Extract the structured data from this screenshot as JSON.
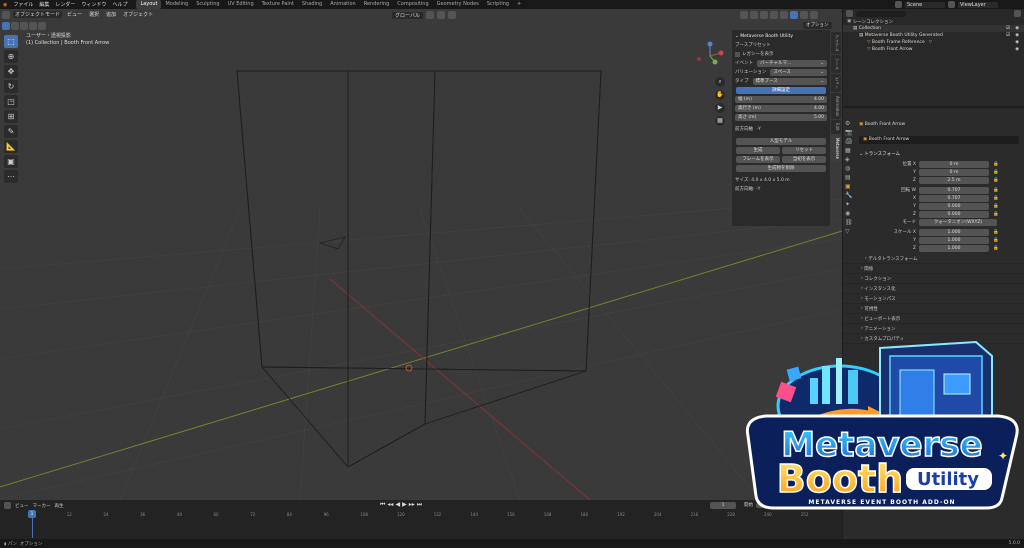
{
  "menu": [
    "ファイル",
    "編集",
    "レンダー",
    "ウィンドウ",
    "ヘルプ"
  ],
  "workspaces": [
    {
      "label": "Layout",
      "active": true
    },
    {
      "label": "Modeling"
    },
    {
      "label": "Sculpting"
    },
    {
      "label": "UV Editing"
    },
    {
      "label": "Texture Paint"
    },
    {
      "label": "Shading"
    },
    {
      "label": "Animation"
    },
    {
      "label": "Rendering"
    },
    {
      "label": "Compositing"
    },
    {
      "label": "Geometry Nodes"
    },
    {
      "label": "Scripting"
    }
  ],
  "scene": {
    "name": "Scene",
    "viewlayer": "ViewLayer"
  },
  "viewport": {
    "mode": "オブジェクトモード",
    "menus": [
      "ビュー",
      "選択",
      "追加",
      "オブジェクト"
    ],
    "orientation": "グローバル",
    "options_label": "オプション",
    "info_line1": "ユーザー・透視投影",
    "info_line2": "(1) Collection | Booth Front Arrow"
  },
  "npanel": {
    "header": "Metaverse Booth Utility",
    "preset_label": "ブースプリセット",
    "legacy_label": "レガシーを表示",
    "event_label": "イベント",
    "event_value": "バーチャルマ...",
    "variation_label": "バリエーション",
    "variation_value": "スペース",
    "type_label": "タイプ",
    "type_value": "標準ブース",
    "detail_btn": "詳細設定",
    "width_label": "幅 (m)",
    "width_value": "4.00",
    "depth_label": "奥行き (m)",
    "depth_value": "4.00",
    "height_label": "高さ (m)",
    "height_value": "5.00",
    "front_label": "前方向軸",
    "front_value": "-Y",
    "model_btn": "人型モデル",
    "generate_btn": "生成",
    "reset_btn": "リセット",
    "frame_show_btn": "フレームを表示",
    "guide_show_btn": "当初を表示",
    "delete_btn": "生成物を削除",
    "size_text": "サイズ: 4.0 x 4.0 x 5.0 m",
    "front_text": "前方向軸: -Y"
  },
  "vtabs": [
    {
      "label": "アイテム"
    },
    {
      "label": "ツール"
    },
    {
      "label": "ビュー"
    },
    {
      "label": "Animation"
    },
    {
      "label": "Edit"
    },
    {
      "label": "Metaverse",
      "active": true
    }
  ],
  "timeline": {
    "menus": [
      "ビュー",
      "マーカー",
      "再生"
    ],
    "current_frame": "1",
    "start_label": "開始",
    "start_value": "1",
    "ticks": [
      "0",
      "12",
      "24",
      "36",
      "48",
      "60",
      "72",
      "84",
      "96",
      "108",
      "120",
      "132",
      "144",
      "156",
      "168",
      "180",
      "192",
      "204",
      "216",
      "228",
      "240",
      "252"
    ]
  },
  "outliner": {
    "root": "シーンコレクション",
    "items": [
      {
        "label": "Collection",
        "level": 1
      },
      {
        "label": "Metaverse Booth Utility Generated",
        "level": 2
      },
      {
        "label": "Booth Frame Reference",
        "level": 3
      },
      {
        "label": "Booth Front Arrow",
        "level": 3
      }
    ]
  },
  "properties": {
    "object_name": "Booth Front Arrow",
    "object_field": "Booth Front Arrow",
    "transform_label": "トランスフォーム",
    "loc_label": "位置 X",
    "loc": [
      "0 m",
      "0 m",
      "2.5 m"
    ],
    "rot_label": "回転 W",
    "rot": [
      "0.707",
      "0.707",
      "0.000",
      "0.000"
    ],
    "mode_label": "モード",
    "mode_value": "クォータニオン(WXYZ)",
    "scale_label": "スケール X",
    "scale": [
      "1.000",
      "1.000",
      "1.000"
    ],
    "axis_y": "Y",
    "axis_z": "Z",
    "axis_x": "X",
    "sections": [
      "デルタトランスフォーム",
      "関係",
      "コレクション",
      "インスタンス化",
      "モーションパス",
      "可視性",
      "ビューポート表示",
      "アニメーション",
      "カスタムプロパティ"
    ]
  },
  "logo": {
    "word1": "Metaverse",
    "word2": "Booth",
    "word3": "Utility",
    "tagline": "METAVERSE EVENT BOOTH ADD-ON"
  },
  "status": {
    "left": "パン",
    "mid": "オプション",
    "version": "5.0.0"
  }
}
